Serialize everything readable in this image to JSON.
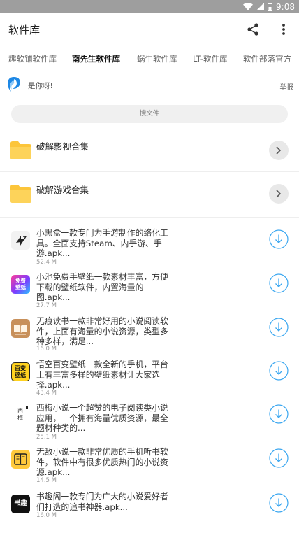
{
  "status_bar": {
    "time": "9:08"
  },
  "app_bar": {
    "title": "软件库"
  },
  "tabs": [
    {
      "label": "趣软铺软件库"
    },
    {
      "label": "南先生软件库"
    },
    {
      "label": "蜗牛软件库"
    },
    {
      "label": "LT-软件库"
    },
    {
      "label": "软件部落官方"
    }
  ],
  "notice": {
    "text": "是你呀!",
    "report_label": "举报"
  },
  "search": {
    "label": "搜文件"
  },
  "folders": [
    {
      "name": "破解影视合集"
    },
    {
      "name": "破解游戏合集"
    }
  ],
  "apps": [
    {
      "desc": "小黑盒一款专门为手游制作的络化工具。全面支持Steam、内手游、手游.apk...",
      "size": "52.4 M",
      "icon": "heybox-icon"
    },
    {
      "desc": "小池免费手壁纸一款素材丰富，方便下载的壁纸软件，内置海量的图.apk...",
      "size": "27.7 M",
      "icon": "wallpaper-icon",
      "icon_text": [
        "免费",
        "壁纸"
      ]
    },
    {
      "desc": "无痕读书一款非常好用的小说阅读软件，上面有海量的小说资源，类型多种多样，满足...",
      "size": "16.0 M",
      "icon": "book-reader-icon"
    },
    {
      "desc": "悟空百变壁纸一款全新的手机，平台上有丰富多样的壁纸素材让大家选择.apk...",
      "size": "43.4 M",
      "icon": "wukong-wallpaper-icon",
      "icon_text": [
        "百变",
        "壁纸"
      ]
    },
    {
      "desc": "西梅小说一个超赞的电子阅读类小说应用，一个拥有海量优质资源，最全题材种类的...",
      "size": "25.1 M",
      "icon": "ximei-icon",
      "icon_text": [
        "西",
        "梅"
      ]
    },
    {
      "desc": "无敌小说一款非常优质的手机听书软件，软件中有很多优质热门的小说资源.apk...",
      "size": "14.5 M",
      "icon": "novel-icon"
    },
    {
      "desc": "书趣阁一款专门为广大的小说爱好者们打造的追书神器.apk...",
      "size": "16.0 M",
      "icon": "shuqu-icon",
      "icon_text": [
        "书趣"
      ]
    }
  ],
  "colors": {
    "accent": "#3ba7f0",
    "status_bar": "#9e9e9e",
    "folder": "#fcc53a"
  }
}
